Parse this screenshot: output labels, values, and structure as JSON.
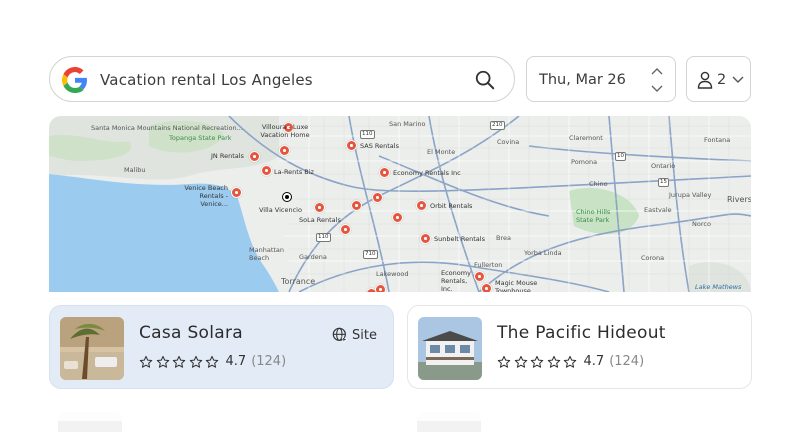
{
  "search": {
    "query": "Vacation rental Los Angeles",
    "logo_icon": "google-g-icon",
    "search_icon": "magnifier-icon"
  },
  "date": {
    "value": "Thu, Mar 26",
    "stepper_icon": "up-down-chevron-icon"
  },
  "guests": {
    "count": "2",
    "person_icon": "person-icon",
    "dropdown_icon": "chevron-down-icon"
  },
  "map": {
    "area_labels": [
      "Santa Monica Mountains National Recreation...",
      "Topanga State Park",
      "Malibu",
      "San Marino",
      "El Monte",
      "Covina",
      "Claremont",
      "Pomona",
      "Ontario",
      "Fontana",
      "Chino",
      "Jurupa Valley",
      "Chino Hills State Park",
      "Eastvale",
      "Riversi",
      "Norco",
      "Brea",
      "Yorba Linda",
      "Fullerton",
      "Corona",
      "Torrance",
      "Manhattan Beach",
      "Gardena",
      "Lakewood",
      "Lake Mathews"
    ],
    "rental_labels": [
      "Villoura - Luxe Vacation Home",
      "JN Rentals",
      "La-Rents Biz",
      "SAS Rentals",
      "Economy Rentals Inc",
      "Venice Beach Rentals - Venice...",
      "Villa Vicencio",
      "SoLa Rentals",
      "Orbit Rentals",
      "Sunbelt Rentals",
      "Economy Rentals, Inc.",
      "Magic Mouse Townhouse"
    ]
  },
  "listings": [
    {
      "title": "Casa Solara",
      "rating": "4.7",
      "reviews": "(124)",
      "site_label": "Site",
      "selected": true
    },
    {
      "title": "The Pacific Hideout",
      "rating": "4.7",
      "reviews": "(124)",
      "selected": false
    }
  ],
  "colors": {
    "pin": "#e6553d",
    "selected_card": "#e3ebf6",
    "water": "#9ccbf0",
    "park": "#c8e3c4"
  }
}
